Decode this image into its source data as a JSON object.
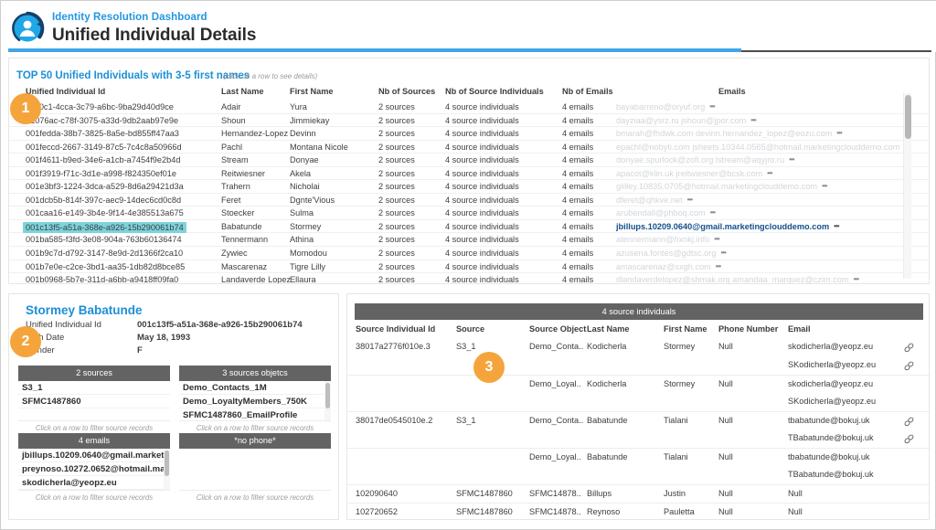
{
  "header": {
    "subtitle": "Identity Resolution Dashboard",
    "title": "Unified Individual Details",
    "logo_icon": "identity-person-refresh-icon",
    "accent_blue": "#41a6e8",
    "accent_dark": "#4d4d4d"
  },
  "top_panel": {
    "title": "TOP 50 Unified Individuals with 3-5 first names",
    "hint": "(click on a row to see details)",
    "columns": [
      "Unified Individual Id",
      "Last Name",
      "First Name",
      "Nb of Sources",
      "Nb of Source Individuals",
      "Nb of Emails",
      "Emails"
    ],
    "rows": [
      {
        "id": "20c0c1-4cca-3c79-a6bc-9ba29d40d9ce",
        "last": "Adair",
        "first": "Yura",
        "nb_sources": "2 sources",
        "nb_source_individuals": "4 source individuals",
        "nb_emails": "4 emails",
        "emails": "bayabarreno@oryuf.org",
        "selected": false
      },
      {
        "id": "02076ac-c78f-3075-a33d-9db2aab97e9e",
        "last": "Shoun",
        "first": "Jimmiekay",
        "nb_sources": "2 sources",
        "nb_source_individuals": "4 source individuals",
        "nb_emails": "4 emails",
        "emails": "dayziaa@ysrz.ru   jshoun@jpor.com",
        "selected": false
      },
      {
        "id": "001fedda-38b7-3825-8a5e-bd855ff47aa3",
        "last": "Hernandez-Lopez",
        "first": "Devinn",
        "nb_sources": "2 sources",
        "nb_source_individuals": "4 source individuals",
        "nb_emails": "4 emails",
        "emails": "bmarah@fhdwk.com   devinn.hernandez_lopez@eozu.com",
        "selected": false
      },
      {
        "id": "001feccd-2667-3149-87c5-7c4c8a50966d",
        "last": "Pachl",
        "first": "Montana Nicole",
        "nb_sources": "2 sources",
        "nb_source_individuals": "4 source individuals",
        "nb_emails": "4 emails",
        "emails": "epachl@nobyti.com   jsheets.10344.0565@hotmail.marketingclouddemo.com",
        "selected": false
      },
      {
        "id": "001f4611-b9ed-34e6-a1cb-a7454f9e2b4d",
        "last": "Stream",
        "first": "Donyae",
        "nb_sources": "2 sources",
        "nb_source_individuals": "4 source individuals",
        "nb_emails": "4 emails",
        "emails": "donyae.spurlock@zofi.org   lstream@aqyjro.ru",
        "selected": false
      },
      {
        "id": "001f3919-f71c-3d1e-a998-f824350ef01e",
        "last": "Reitwiesner",
        "first": "Akela",
        "nb_sources": "2 sources",
        "nb_source_individuals": "4 source individuals",
        "nb_emails": "4 emails",
        "emails": "apacot@klin.uk   jreitwiesner@bcsk.com",
        "selected": false
      },
      {
        "id": "001e3bf3-1224-3dca-a529-8d6a29421d3a",
        "last": "Trahern",
        "first": "Nicholai",
        "nb_sources": "2 sources",
        "nb_source_individuals": "4 source individuals",
        "nb_emails": "4 emails",
        "emails": "glilley.10835.0705@hotmail.marketingclouddemo.com",
        "selected": false
      },
      {
        "id": "001dcb5b-814f-397c-aec9-14dec6cd0c8d",
        "last": "Feret",
        "first": "Dgnte'Vious",
        "nb_sources": "2 sources",
        "nb_source_individuals": "4 source individuals",
        "nb_emails": "4 emails",
        "emails": "dferet@qhkve.net",
        "selected": false
      },
      {
        "id": "001caa16-e149-3b4e-9f14-4e385513a675",
        "last": "Stoecker",
        "first": "Sulma",
        "nb_sources": "2 sources",
        "nb_source_individuals": "4 source individuals",
        "nb_emails": "4 emails",
        "emails": "arubendall@phboq.com",
        "selected": false
      },
      {
        "id": "001c13f5-a51a-368e-a926-15b290061b74",
        "last": "Babatunde",
        "first": "Stormey",
        "nb_sources": "2 sources",
        "nb_source_individuals": "4 source individuals",
        "nb_emails": "4 emails",
        "emails": "jbillups.10209.0640@gmail.marketingclouddemo.com",
        "selected": true
      },
      {
        "id": "001ba585-f3fd-3e08-904a-763b60136474",
        "last": "Tennermann",
        "first": "Athina",
        "nb_sources": "2 sources",
        "nb_source_individuals": "4 source individuals",
        "nb_emails": "4 emails",
        "emails": "atennermann@hxnkj.info",
        "selected": false
      },
      {
        "id": "001b9c7d-d792-3147-8e9d-2d1366f2ca10",
        "last": "Zywiec",
        "first": "Momodou",
        "nb_sources": "2 sources",
        "nb_source_individuals": "4 source individuals",
        "nb_emails": "4 emails",
        "emails": "azusena.fontes@gdtsc.org",
        "selected": false
      },
      {
        "id": "001b7e0e-c2ce-3bd1-aa35-1db82d8bce85",
        "last": "Mascarenaz",
        "first": "Tigre Lilly",
        "nb_sources": "2 sources",
        "nb_source_individuals": "4 source individuals",
        "nb_emails": "4 emails",
        "emails": "amascarenaz@sxgh.com",
        "selected": false
      },
      {
        "id": "001b0968-5b7e-311d-a6bb-a9418ff09fa0",
        "last": "Landaverde Lopez",
        "first": "Ellaura",
        "nb_sources": "2 sources",
        "nb_source_individuals": "4 source individuals",
        "nb_emails": "4 emails",
        "emails": "dlandaverdelopez@shmak.org   amandaa_marquez@czim.com",
        "selected": false
      }
    ],
    "overflow_dots": "•••"
  },
  "detail_panel": {
    "person_name": "Stormey Babatunde",
    "fields": [
      {
        "label": "Unified Individual Id",
        "value": "001c13f5-a51a-368e-a926-15b290061b74"
      },
      {
        "label": "Birth Date",
        "value": "May 18, 1993"
      },
      {
        "label": "Gender",
        "value": "F"
      }
    ],
    "footer_hint": "Click on a row to filter source records",
    "boxes": [
      {
        "title": "2 sources",
        "items": [
          "S3_1",
          "SFMC1487860"
        ],
        "scroll": false
      },
      {
        "title": "3 sources objetcs",
        "items": [
          "Demo_Contacts_1M",
          "Demo_LoyaltyMembers_750K",
          "SFMC1487860_EmailProfile"
        ],
        "scroll": true
      },
      {
        "title": "4 emails",
        "items": [
          "jbillups.10209.0640@gmail.marketi",
          "preynoso.10272.0652@hotmail.mar",
          "skodicherla@yeopz.eu"
        ],
        "scroll": true
      },
      {
        "title": "*no phone*",
        "items": [],
        "scroll": false
      }
    ]
  },
  "source_panel": {
    "title": "4 source individuals",
    "columns": [
      "Source Individual Id",
      "Source",
      "Source Object",
      "Last Name",
      "First Name",
      "Phone Number",
      "Email"
    ],
    "link_icon": "chain-link-icon",
    "rows": [
      {
        "id": "38017a2776f010e.3",
        "source": "S3_1",
        "object": "Demo_Conta..",
        "last": "Kodicherla",
        "first": "Stormey",
        "phone": "Null",
        "email": "skodicherla@yeopz.eu",
        "link": true,
        "sep": false
      },
      {
        "id": "",
        "source": "",
        "object": "",
        "last": "",
        "first": "",
        "phone": "",
        "email": "SKodicherla@yeopz.eu",
        "link": true,
        "sep": false
      },
      {
        "id": "",
        "source": "",
        "object": "Demo_Loyal..",
        "last": "Kodicherla",
        "first": "Stormey",
        "phone": "Null",
        "email": "skodicherla@yeopz.eu",
        "link": false,
        "sep": true
      },
      {
        "id": "",
        "source": "",
        "object": "",
        "last": "",
        "first": "",
        "phone": "",
        "email": "SKodicherla@yeopz.eu",
        "link": false,
        "sep": false
      },
      {
        "id": "38017de0545010e.2",
        "source": "S3_1",
        "object": "Demo_Conta..",
        "last": "Babatunde",
        "first": "Tialani",
        "phone": "Null",
        "email": "tbabatunde@bokuj.uk",
        "link": true,
        "sep": true
      },
      {
        "id": "",
        "source": "",
        "object": "",
        "last": "",
        "first": "",
        "phone": "",
        "email": "TBabatunde@bokuj.uk",
        "link": true,
        "sep": false
      },
      {
        "id": "",
        "source": "",
        "object": "Demo_Loyal..",
        "last": "Babatunde",
        "first": "Tialani",
        "phone": "Null",
        "email": "tbabatunde@bokuj.uk",
        "link": false,
        "sep": true
      },
      {
        "id": "",
        "source": "",
        "object": "",
        "last": "",
        "first": "",
        "phone": "",
        "email": "TBabatunde@bokuj.uk",
        "link": false,
        "sep": false
      },
      {
        "id": "102090640",
        "source": "SFMC1487860",
        "object": "SFMC14878..",
        "last": "Billups",
        "first": "Justin",
        "phone": "Null",
        "email": "Null",
        "link": false,
        "sep": true
      },
      {
        "id": "102720652",
        "source": "SFMC1487860",
        "object": "SFMC14878..",
        "last": "Reynoso",
        "first": "Pauletta",
        "phone": "Null",
        "email": "Null",
        "link": false,
        "sep": true
      }
    ]
  },
  "callouts": [
    {
      "number": "1"
    },
    {
      "number": "2"
    },
    {
      "number": "3"
    }
  ]
}
